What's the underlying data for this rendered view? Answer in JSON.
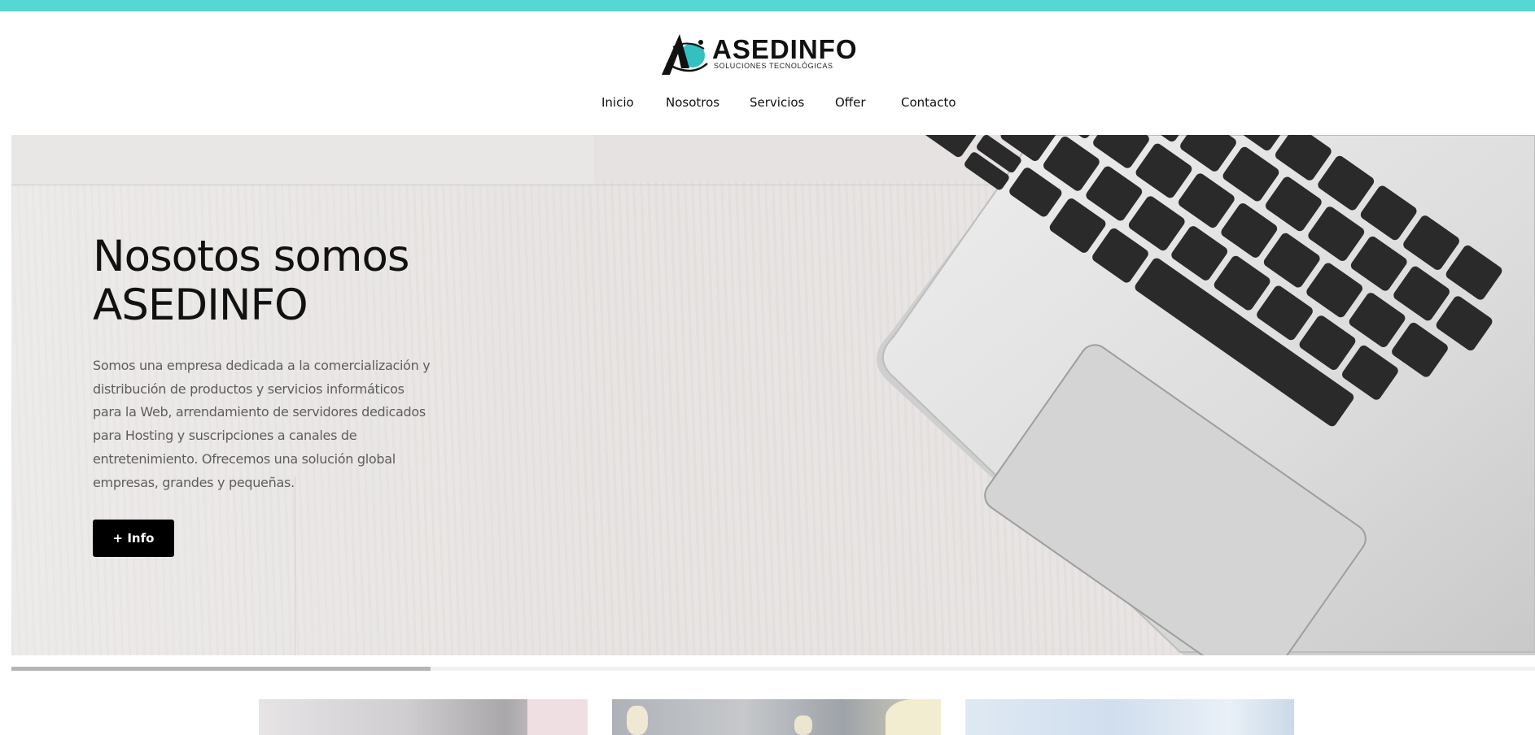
{
  "colors": {
    "top_bar": "#55d7d2",
    "brand_teal": "#34bfc0",
    "button_bg": "#000000",
    "button_text": "#ffffff",
    "progress_fill": "#b5b5b5"
  },
  "logo": {
    "icon": "asedinfo-logo-icon",
    "name": "ASEDINFO",
    "tagline": "SOLUCIONES TECNOLÓGICAS"
  },
  "nav": {
    "items": [
      {
        "label": "Inicio"
      },
      {
        "label": "Nosotros"
      },
      {
        "label": "Servicios"
      },
      {
        "label": "Offer"
      },
      {
        "label": "Contacto"
      }
    ]
  },
  "hero": {
    "title_lines": [
      "Nosotos somos",
      "ASEDINFO"
    ],
    "description_lines": [
      "Somos una empresa dedicada a la comercialización y",
      "distribución de productos y servicios informáticos",
      "para la Web, arrendamiento de servidores dedicados",
      "para Hosting y suscripciones a canales de",
      "entretenimiento. Ofrecemos una solución global",
      "empresas, grandes y pequeñas."
    ],
    "button_label": "+ Info",
    "background_image": "laptop-on-wood-desk"
  },
  "slider": {
    "progress": 0.275
  },
  "cards": [
    {
      "image": "card-image-1"
    },
    {
      "image": "card-image-2"
    },
    {
      "image": "card-image-3"
    }
  ]
}
